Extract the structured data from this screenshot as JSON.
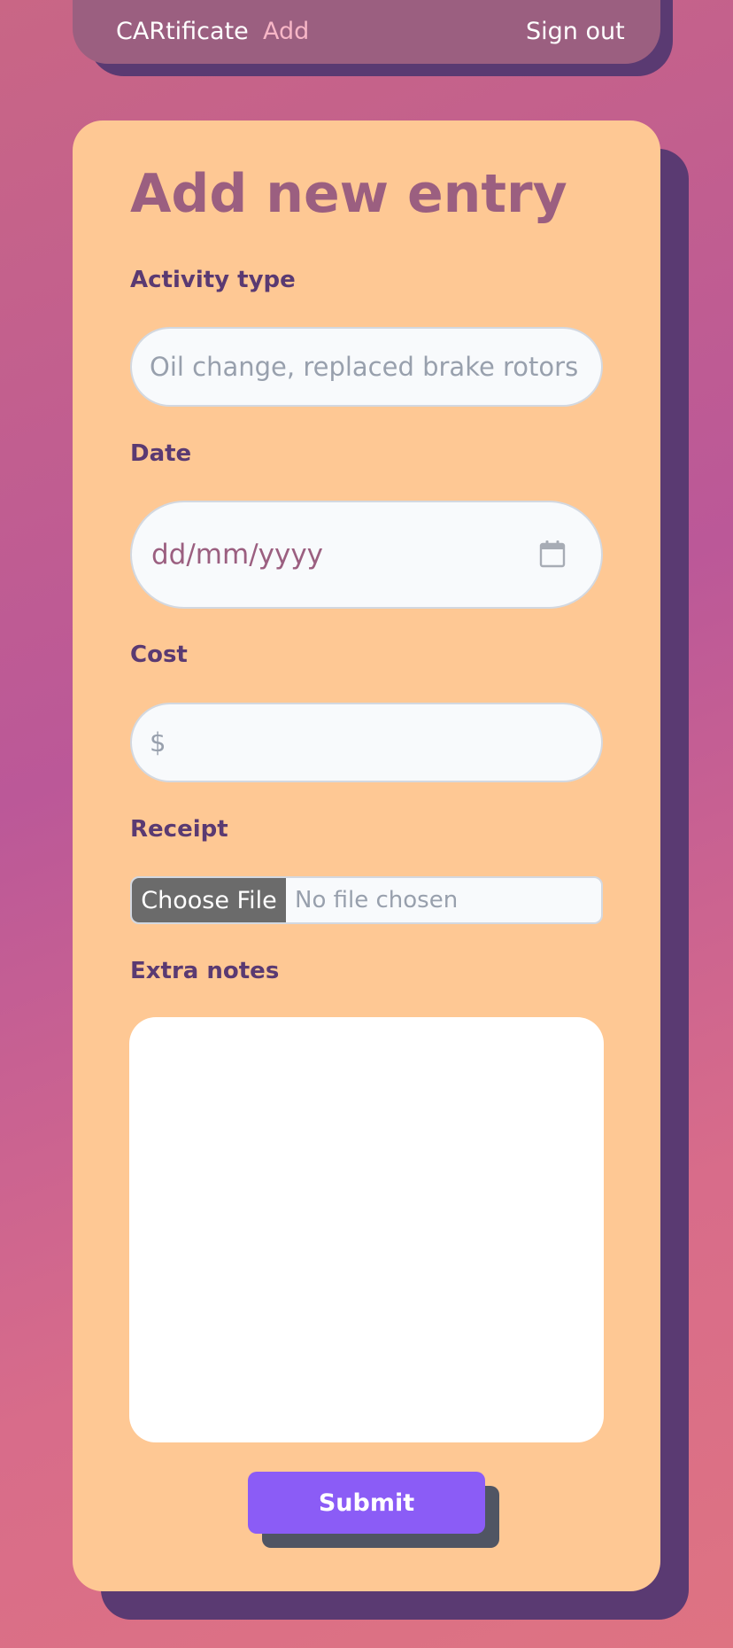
{
  "nav": {
    "brand": "CARtificate",
    "add": "Add",
    "sign_out": "Sign out"
  },
  "form": {
    "title": "Add new entry",
    "activity_type": {
      "label": "Activity type",
      "placeholder": "Oil change, replaced brake rotors"
    },
    "date": {
      "label": "Date",
      "placeholder": "dd/mm/yyyy",
      "icon": "calendar-icon"
    },
    "cost": {
      "label": "Cost",
      "prefix": "$",
      "value": ""
    },
    "receipt": {
      "label": "Receipt",
      "button": "Choose File",
      "status": "No file chosen"
    },
    "notes": {
      "label": "Extra notes",
      "value": ""
    },
    "submit": "Submit"
  },
  "colors": {
    "nav_bg": "#9b5f80",
    "shadow": "#5a3a72",
    "card_bg": "#fec894",
    "title": "#9b5f80",
    "label": "#5a3a72",
    "accent": "#8b5cf6",
    "add_link": "#f7b6c6"
  }
}
